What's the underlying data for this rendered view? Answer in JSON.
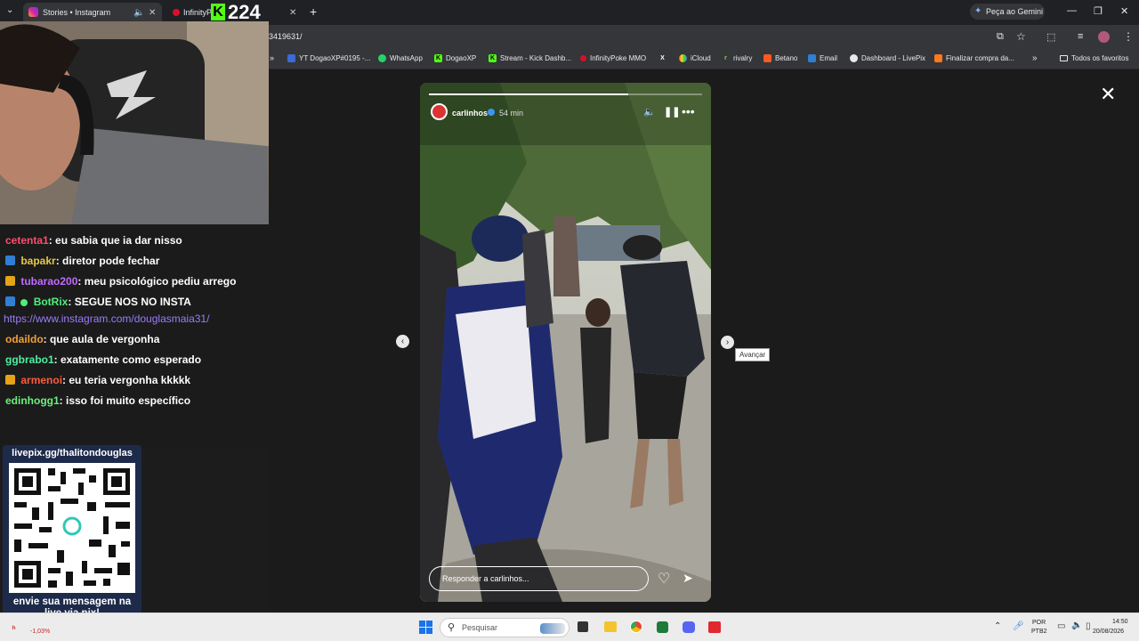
{
  "tabs": [
    {
      "label": "Stories • Instagram",
      "active": true
    },
    {
      "label": "InfinityP...",
      "active": false
    }
  ],
  "overlay_count": "224",
  "gemini_label": "Peça ao Gemini",
  "address": {
    "url": "3419631/"
  },
  "bookmarks": [
    "YT DogaoXP#0195 -...",
    "WhatsApp",
    "DogaoXP",
    "Stream - Kick Dashb...",
    "InfinityPoke MMO",
    "iCloud",
    "rivalry",
    "Betano",
    "Email",
    "Dashboard - LivePix",
    "Finalizar compra da..."
  ],
  "all_favorites": "Todos os favoritos",
  "chat": [
    {
      "user": "cetenta1",
      "color": "#ff4d6d",
      "text": ": eu sabia que ia dar nisso",
      "badge": ""
    },
    {
      "user": "bapakr",
      "color": "#e6c84a",
      "text": ": diretor pode fechar",
      "badge": "#2f7fd6"
    },
    {
      "user": "tubarao200",
      "color": "#c06bff",
      "text": ": meu psicológico pediu arrego",
      "badge": "#e6a317"
    },
    {
      "user": "BotRix",
      "color": "#4ef07a",
      "text": ": SEGUE NOS NO INSTA",
      "badge": "#2f7fd6"
    },
    {
      "user": "",
      "color": "#9b7bff",
      "text": "https://www.instagram.com/douglasmaia31/",
      "badge": ""
    },
    {
      "user": "odaildo",
      "color": "#f0a03a",
      "text": ": que aula de vergonha",
      "badge": ""
    },
    {
      "user": "ggbrabo1",
      "color": "#4ef0a0",
      "text": ": exatamente como esperado",
      "badge": ""
    },
    {
      "user": "armenoi",
      "color": "#ff5a3a",
      "text": ": eu teria vergonha kkkkk",
      "badge": "#e6a317"
    },
    {
      "user": "edinhogg1",
      "color": "#6bf07a",
      "text": ": isso foi muito específico",
      "badge": ""
    }
  ],
  "qr": {
    "title": "livepix.gg/thalitondouglas",
    "caption": "envie sua mensagem na live via pix!"
  },
  "story": {
    "username": "carlinhos",
    "time": "54 min",
    "reply_placeholder": "Responder a carlinhos...",
    "next_tooltip": "Avançar"
  },
  "taskbar": {
    "search_placeholder": "Pesquisar",
    "lang": "POR",
    "lang2": "PTB2",
    "time": "14:50",
    "date": "20/08/2026",
    "stock": "-1,03%"
  }
}
